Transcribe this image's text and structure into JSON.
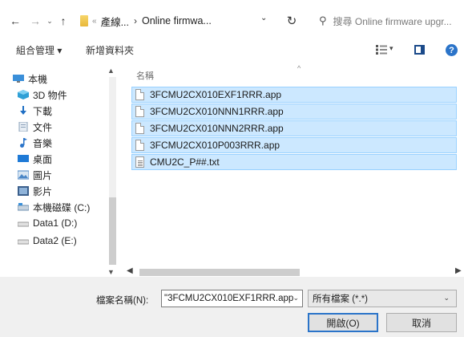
{
  "address_bar": {
    "breadcrumb": [
      "產線...",
      "Online firmwa..."
    ],
    "overflow": "«",
    "arrow": "›",
    "search_placeholder": "搜尋 Online firmware upgr..."
  },
  "toolbar": {
    "organize": "組合管理 ▾",
    "new_folder": "新增資料夾"
  },
  "nav_pane": {
    "items": [
      {
        "label": "本機",
        "icon": "computer-icon",
        "color": "#3a8fd9"
      },
      {
        "label": "3D 物件",
        "icon": "3d-objects-icon",
        "color": "#2fa0d6"
      },
      {
        "label": "下載",
        "icon": "downloads-icon",
        "color": "#1f6fc4"
      },
      {
        "label": "文件",
        "icon": "documents-icon",
        "color": "#8aa0b8"
      },
      {
        "label": "音樂",
        "icon": "music-icon",
        "color": "#2b74c9"
      },
      {
        "label": "桌面",
        "icon": "desktop-icon",
        "color": "#1f7ad6"
      },
      {
        "label": "圖片",
        "icon": "pictures-icon",
        "color": "#4a86c6"
      },
      {
        "label": "影片",
        "icon": "videos-icon",
        "color": "#3b5f8c"
      },
      {
        "label": "本機磁碟 (C:)",
        "icon": "local-disk-icon",
        "color": "#6d8fb0"
      },
      {
        "label": "Data1 (D:)",
        "icon": "drive-icon",
        "color": "#9a9a9a"
      },
      {
        "label": "Data2 (E:)",
        "icon": "drive-icon",
        "color": "#9a9a9a"
      }
    ]
  },
  "file_list": {
    "column_name": "名稱",
    "files": [
      {
        "name": "3FCMU2CX010EXF1RRR.app",
        "type": "app"
      },
      {
        "name": "3FCMU2CX010NNN1RRR.app",
        "type": "app"
      },
      {
        "name": "3FCMU2CX010NNN2RRR.app",
        "type": "app"
      },
      {
        "name": "3FCMU2CX010P003RRR.app",
        "type": "app"
      },
      {
        "name": "CMU2C_P##.txt",
        "type": "txt"
      }
    ]
  },
  "bottom": {
    "filename_label": "檔案名稱(N):",
    "filename_value": "\"3FCMU2CX010EXF1RRR.app",
    "filetype_value": "所有檔案 (*.*)",
    "open_button": "開啟(O)",
    "cancel_button": "取消"
  }
}
